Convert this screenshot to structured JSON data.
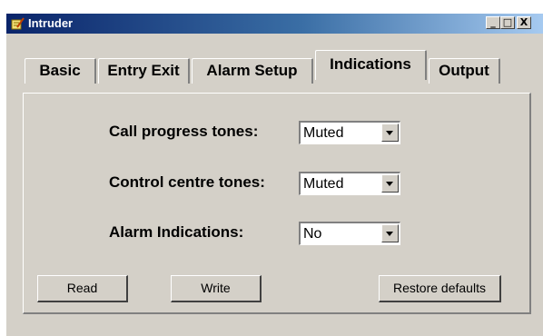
{
  "window": {
    "title": "Intruder",
    "icon": "pencil-notepad-icon",
    "controls": {
      "minimize": "_",
      "maximize": "□",
      "close": "X"
    }
  },
  "tabs": [
    {
      "label": "Basic",
      "active": false
    },
    {
      "label": "Entry Exit",
      "active": false
    },
    {
      "label": "Alarm Setup",
      "active": false
    },
    {
      "label": "Indications",
      "active": true
    },
    {
      "label": "Output",
      "active": false
    }
  ],
  "fields": {
    "call_progress": {
      "label": "Call progress tones:",
      "value": "Muted"
    },
    "control_centre": {
      "label": "Control centre tones:",
      "value": "Muted"
    },
    "alarm_indications": {
      "label": "Alarm Indications:",
      "value": "No"
    }
  },
  "buttons": {
    "read": "Read",
    "write": "Write",
    "restore": "Restore defaults"
  },
  "colors": {
    "face": "#d4d0c8",
    "titlebar_start": "#0a246a",
    "titlebar_end": "#a6caf0"
  }
}
